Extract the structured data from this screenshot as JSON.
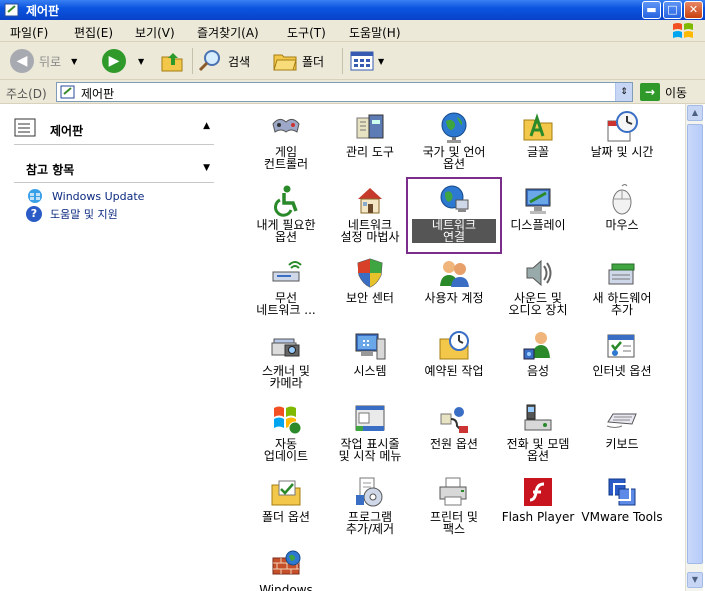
{
  "window": {
    "title": "제어판",
    "min": "▬",
    "max": "□",
    "close": "✕"
  },
  "menu": [
    "파일(F)",
    "편집(E)",
    "보기(V)",
    "즐겨찾기(A)",
    "도구(T)",
    "도움말(H)"
  ],
  "toolbar": {
    "back": "뒤로",
    "search": "검색",
    "folders": "폴더"
  },
  "address": {
    "label": "주소(D)",
    "value": "제어판",
    "go": "이동"
  },
  "left": {
    "panel_title": "제어판",
    "see_also": "참고 항목",
    "links": [
      "Windows Update",
      "도움말 및 지원"
    ]
  },
  "items": [
    {
      "label": "게임\n컨트롤러",
      "icon": "game-controller-icon"
    },
    {
      "label": "관리 도구",
      "icon": "admin-tools-icon"
    },
    {
      "label": "국가 및 언어\n옵션",
      "icon": "globe-icon"
    },
    {
      "label": "글꼴",
      "icon": "fonts-folder-icon"
    },
    {
      "label": "날짜 및 시간",
      "icon": "clock-icon"
    },
    {
      "label": "내게 필요한\n옵션",
      "icon": "accessibility-icon"
    },
    {
      "label": "네트워크\n설정 마법사",
      "icon": "network-wizard-icon"
    },
    {
      "label": "네트워크\n연결",
      "icon": "network-connections-icon"
    },
    {
      "label": "디스플레이",
      "icon": "display-icon"
    },
    {
      "label": "마우스",
      "icon": "mouse-icon"
    },
    {
      "label": "무선\n네트워크 ...",
      "icon": "wireless-network-icon"
    },
    {
      "label": "보안 센터",
      "icon": "security-shield-icon"
    },
    {
      "label": "사용자 계정",
      "icon": "user-accounts-icon"
    },
    {
      "label": "사운드 및\n오디오 장치",
      "icon": "speaker-icon"
    },
    {
      "label": "새 하드웨어\n추가",
      "icon": "add-hardware-icon"
    },
    {
      "label": "스캐너 및\n카메라",
      "icon": "scanner-camera-icon"
    },
    {
      "label": "시스템",
      "icon": "system-computer-icon"
    },
    {
      "label": "예약된 작업",
      "icon": "scheduled-tasks-icon"
    },
    {
      "label": "음성",
      "icon": "speech-icon"
    },
    {
      "label": "인터넷 옵션",
      "icon": "internet-options-icon"
    },
    {
      "label": "자동\n업데이트",
      "icon": "windows-flag-icon"
    },
    {
      "label": "작업 표시줄\n및 시작 메뉴",
      "icon": "taskbar-icon"
    },
    {
      "label": "전원 옵션",
      "icon": "power-icon"
    },
    {
      "label": "전화 및 모뎀\n옵션",
      "icon": "phone-modem-icon"
    },
    {
      "label": "키보드",
      "icon": "keyboard-icon"
    },
    {
      "label": "폴더 옵션",
      "icon": "folder-options-icon"
    },
    {
      "label": "프로그램\n추가/제거",
      "icon": "add-remove-programs-icon"
    },
    {
      "label": "프린터 및\n팩스",
      "icon": "printer-icon"
    },
    {
      "label": "Flash Player",
      "icon": "flash-player-icon"
    },
    {
      "label": "VMware Tools",
      "icon": "vmware-tools-icon"
    },
    {
      "label": "Windows",
      "icon": "firewall-icon"
    }
  ]
}
